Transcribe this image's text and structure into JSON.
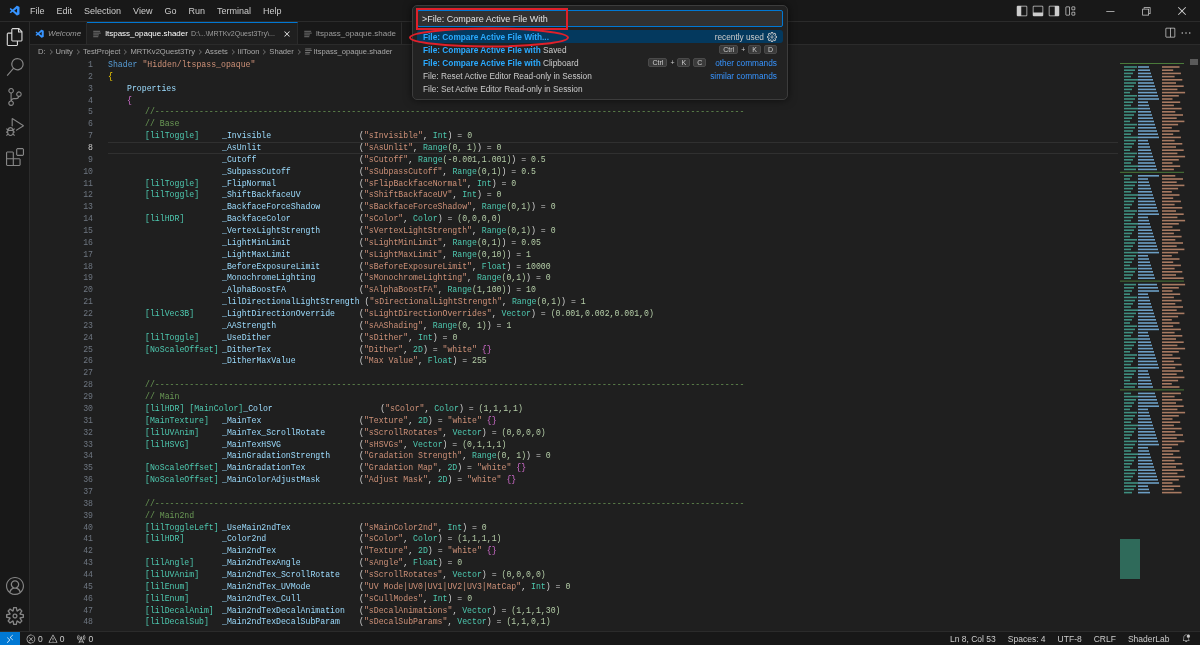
{
  "menu": [
    "File",
    "Edit",
    "Selection",
    "View",
    "Go",
    "Run",
    "Terminal",
    "Help"
  ],
  "tabs": [
    {
      "label": "Welcome",
      "preview": true,
      "selected": false
    },
    {
      "label": "ltspass_opaque.shader",
      "description": "D:\\...\\MRTKv2Quest3Try\\...",
      "preview": false,
      "selected": true
    },
    {
      "label": "ltspass_opaque.shade",
      "preview": false,
      "selected": false
    }
  ],
  "breadcrumbs": [
    "D:",
    "Unity",
    "TestProject",
    "MRTKv2Quest3Try",
    "Assets",
    "lilToon",
    "Shader",
    "ltspass_opaque.shader"
  ],
  "editor": {
    "lines": [
      {
        "number": "1",
        "current": false,
        "kind": "header",
        "code": [
          {
            "kind": "keyword",
            "text": "Shader"
          },
          {
            "kind": "string",
            "text": " \"Hidden/ltspass_opaque\""
          }
        ]
      },
      {
        "number": "2",
        "current": false,
        "kind": "header",
        "code": [
          {
            "kind": "bracket",
            "text": "{"
          }
        ]
      },
      {
        "number": "3",
        "current": false,
        "kind": "section",
        "code": [
          {
            "kind": "variable",
            "text": "Properties"
          }
        ]
      },
      {
        "number": "4",
        "current": false,
        "kind": "section",
        "code": [
          {
            "kind": "brace",
            "text": "{"
          }
        ]
      },
      {
        "number": "5",
        "current": false,
        "kind": "comment",
        "text": "//------------------------------------------------------------------------------------------------------------------------"
      },
      {
        "number": "6",
        "current": false,
        "kind": "comment",
        "text": "// Base"
      },
      {
        "number": "7",
        "current": false,
        "kind": "decl",
        "attr": "[lilToggle]",
        "name": "_Invisible",
        "desc": [
          {
            "kind": "plain",
            "text": "("
          },
          {
            "kind": "string",
            "text": "\"sInvisible\""
          },
          {
            "kind": "plain",
            "text": ", "
          },
          {
            "kind": "type",
            "text": "Int"
          },
          {
            "kind": "plain",
            "text": ") = "
          },
          {
            "kind": "number",
            "text": "0"
          }
        ]
      },
      {
        "number": "8",
        "current": true,
        "kind": "decl",
        "name": "_AsUnlit",
        "desc": [
          {
            "kind": "plain",
            "text": "("
          },
          {
            "kind": "string",
            "text": "\"sAsUnlit\""
          },
          {
            "kind": "plain",
            "text": ", "
          },
          {
            "kind": "type",
            "text": "Range"
          },
          {
            "kind": "number",
            "text": "(0, 1)"
          },
          {
            "kind": "plain",
            "text": ") = "
          },
          {
            "kind": "number",
            "text": "0"
          }
        ]
      },
      {
        "number": "9",
        "current": false,
        "kind": "decl",
        "name": "_Cutoff",
        "desc": [
          {
            "kind": "plain",
            "text": "("
          },
          {
            "kind": "string",
            "text": "\"sCutoff\""
          },
          {
            "kind": "plain",
            "text": ", "
          },
          {
            "kind": "type",
            "text": "Range"
          },
          {
            "kind": "number",
            "text": "(-0.001,1.001)"
          },
          {
            "kind": "plain",
            "text": ") = "
          },
          {
            "kind": "number",
            "text": "0.5"
          }
        ]
      },
      {
        "number": "10",
        "current": false,
        "kind": "decl",
        "name": "_SubpassCutoff",
        "desc": [
          {
            "kind": "plain",
            "text": "("
          },
          {
            "kind": "string",
            "text": "\"sSubpassCutoff\""
          },
          {
            "kind": "plain",
            "text": ", "
          },
          {
            "kind": "type",
            "text": "Range"
          },
          {
            "kind": "number",
            "text": "(0,1)"
          },
          {
            "kind": "plain",
            "text": ") = "
          },
          {
            "kind": "number",
            "text": "0.5"
          }
        ]
      },
      {
        "number": "11",
        "current": false,
        "kind": "decl",
        "attr": "[lilToggle]",
        "name": "_FlipNormal",
        "desc": [
          {
            "kind": "plain",
            "text": "("
          },
          {
            "kind": "string",
            "text": "\"sFlipBackfaceNormal\""
          },
          {
            "kind": "plain",
            "text": ", "
          },
          {
            "kind": "type",
            "text": "Int"
          },
          {
            "kind": "plain",
            "text": ") = "
          },
          {
            "kind": "number",
            "text": "0"
          }
        ]
      },
      {
        "number": "12",
        "current": false,
        "kind": "decl",
        "attr": "[lilToggle]",
        "name": "_ShiftBackfaceUV",
        "desc": [
          {
            "kind": "plain",
            "text": "("
          },
          {
            "kind": "string",
            "text": "\"sShiftBackfaceUV\""
          },
          {
            "kind": "plain",
            "text": ", "
          },
          {
            "kind": "type",
            "text": "Int"
          },
          {
            "kind": "plain",
            "text": ") = "
          },
          {
            "kind": "number",
            "text": "0"
          }
        ]
      },
      {
        "number": "13",
        "current": false,
        "kind": "decl",
        "name": "_BackfaceForceShadow",
        "desc": [
          {
            "kind": "plain",
            "text": "("
          },
          {
            "kind": "string",
            "text": "\"sBackfaceForceShadow\""
          },
          {
            "kind": "plain",
            "text": ", "
          },
          {
            "kind": "type",
            "text": "Range"
          },
          {
            "kind": "number",
            "text": "(0,1)"
          },
          {
            "kind": "plain",
            "text": ") = "
          },
          {
            "kind": "number",
            "text": "0"
          }
        ]
      },
      {
        "number": "14",
        "current": false,
        "kind": "decl",
        "attr": "[lilHDR]",
        "name": "_BackfaceColor",
        "desc": [
          {
            "kind": "plain",
            "text": "("
          },
          {
            "kind": "string",
            "text": "\"sColor\""
          },
          {
            "kind": "plain",
            "text": ", "
          },
          {
            "kind": "type",
            "text": "Color"
          },
          {
            "kind": "plain",
            "text": ") = "
          },
          {
            "kind": "number",
            "text": "(0,0,0,0)"
          }
        ]
      },
      {
        "number": "15",
        "current": false,
        "kind": "decl",
        "name": "_VertexLightStrength",
        "desc": [
          {
            "kind": "plain",
            "text": "("
          },
          {
            "kind": "string",
            "text": "\"sVertexLightStrength\""
          },
          {
            "kind": "plain",
            "text": ", "
          },
          {
            "kind": "type",
            "text": "Range"
          },
          {
            "kind": "number",
            "text": "(0,1)"
          },
          {
            "kind": "plain",
            "text": ") = "
          },
          {
            "kind": "number",
            "text": "0"
          }
        ]
      },
      {
        "number": "16",
        "current": false,
        "kind": "decl",
        "name": "_LightMinLimit",
        "desc": [
          {
            "kind": "plain",
            "text": "("
          },
          {
            "kind": "string",
            "text": "\"sLightMinLimit\""
          },
          {
            "kind": "plain",
            "text": ", "
          },
          {
            "kind": "type",
            "text": "Range"
          },
          {
            "kind": "number",
            "text": "(0,1)"
          },
          {
            "kind": "plain",
            "text": ") = "
          },
          {
            "kind": "number",
            "text": "0.05"
          }
        ]
      },
      {
        "number": "17",
        "current": false,
        "kind": "decl",
        "name": "_LightMaxLimit",
        "desc": [
          {
            "kind": "plain",
            "text": "("
          },
          {
            "kind": "string",
            "text": "\"sLightMaxLimit\""
          },
          {
            "kind": "plain",
            "text": ", "
          },
          {
            "kind": "type",
            "text": "Range"
          },
          {
            "kind": "number",
            "text": "(0,10)"
          },
          {
            "kind": "plain",
            "text": ") = "
          },
          {
            "kind": "number",
            "text": "1"
          }
        ]
      },
      {
        "number": "18",
        "current": false,
        "kind": "decl",
        "name": "_BeforeExposureLimit",
        "desc": [
          {
            "kind": "plain",
            "text": "("
          },
          {
            "kind": "string",
            "text": "\"sBeforeExposureLimit\""
          },
          {
            "kind": "plain",
            "text": ", "
          },
          {
            "kind": "type",
            "text": "Float"
          },
          {
            "kind": "plain",
            "text": ") = "
          },
          {
            "kind": "number",
            "text": "10000"
          }
        ]
      },
      {
        "number": "19",
        "current": false,
        "kind": "decl",
        "name": "_MonochromeLighting",
        "desc": [
          {
            "kind": "plain",
            "text": "("
          },
          {
            "kind": "string",
            "text": "\"sMonochromeLighting\""
          },
          {
            "kind": "plain",
            "text": ", "
          },
          {
            "kind": "type",
            "text": "Range"
          },
          {
            "kind": "number",
            "text": "(0,1)"
          },
          {
            "kind": "plain",
            "text": ") = "
          },
          {
            "kind": "number",
            "text": "0"
          }
        ]
      },
      {
        "number": "20",
        "current": false,
        "kind": "decl",
        "name": "_AlphaBoostFA",
        "desc": [
          {
            "kind": "plain",
            "text": "("
          },
          {
            "kind": "string",
            "text": "\"sAlphaBoostFA\""
          },
          {
            "kind": "plain",
            "text": ", "
          },
          {
            "kind": "type",
            "text": "Range"
          },
          {
            "kind": "number",
            "text": "(1,100)"
          },
          {
            "kind": "plain",
            "text": ") = "
          },
          {
            "kind": "number",
            "text": "10"
          }
        ]
      },
      {
        "number": "21",
        "current": false,
        "kind": "decl",
        "name": "_lilDirectionalLightStrength",
        "desc": [
          {
            "kind": "plain",
            "text": " ("
          },
          {
            "kind": "string",
            "text": "\"sDirectionalLightStrength\""
          },
          {
            "kind": "plain",
            "text": ", "
          },
          {
            "kind": "type",
            "text": "Range"
          },
          {
            "kind": "number",
            "text": "(0,1)"
          },
          {
            "kind": "plain",
            "text": ") = "
          },
          {
            "kind": "number",
            "text": "1"
          }
        ]
      },
      {
        "number": "22",
        "current": false,
        "kind": "decl",
        "attr": "[lilVec3B]",
        "name": "_LightDirectionOverride",
        "desc": [
          {
            "kind": "plain",
            "text": "("
          },
          {
            "kind": "string",
            "text": "\"sLightDirectionOverrides\""
          },
          {
            "kind": "plain",
            "text": ", "
          },
          {
            "kind": "type",
            "text": "Vector"
          },
          {
            "kind": "plain",
            "text": ") = "
          },
          {
            "kind": "number",
            "text": "(0.001,0.002,0.001,0)"
          }
        ]
      },
      {
        "number": "23",
        "current": false,
        "kind": "decl",
        "name": "_AAStrength",
        "desc": [
          {
            "kind": "plain",
            "text": "("
          },
          {
            "kind": "string",
            "text": "\"sAAShading\""
          },
          {
            "kind": "plain",
            "text": ", "
          },
          {
            "kind": "type",
            "text": "Range"
          },
          {
            "kind": "number",
            "text": "(0, 1)"
          },
          {
            "kind": "plain",
            "text": ") = "
          },
          {
            "kind": "number",
            "text": "1"
          }
        ]
      },
      {
        "number": "24",
        "current": false,
        "kind": "decl",
        "attr": "[lilToggle]",
        "name": "_UseDither",
        "desc": [
          {
            "kind": "plain",
            "text": "("
          },
          {
            "kind": "string",
            "text": "\"sDither\""
          },
          {
            "kind": "plain",
            "text": ", "
          },
          {
            "kind": "type",
            "text": "Int"
          },
          {
            "kind": "plain",
            "text": ") = "
          },
          {
            "kind": "number",
            "text": "0"
          }
        ]
      },
      {
        "number": "25",
        "current": false,
        "kind": "decl",
        "attr": "[NoScaleOffset]",
        "name": "_DitherTex",
        "desc": [
          {
            "kind": "plain",
            "text": "("
          },
          {
            "kind": "string",
            "text": "\"Dither\""
          },
          {
            "kind": "plain",
            "text": ", "
          },
          {
            "kind": "type",
            "text": "2D"
          },
          {
            "kind": "plain",
            "text": ") = "
          },
          {
            "kind": "string",
            "text": "\"white\""
          },
          {
            "kind": "brace",
            "text": " {}"
          }
        ]
      },
      {
        "number": "26",
        "current": false,
        "kind": "decl",
        "name": "_DitherMaxValue",
        "desc": [
          {
            "kind": "plain",
            "text": "("
          },
          {
            "kind": "string",
            "text": "\"Max Value\""
          },
          {
            "kind": "plain",
            "text": ", "
          },
          {
            "kind": "type",
            "text": "Float"
          },
          {
            "kind": "plain",
            "text": ") = "
          },
          {
            "kind": "number",
            "text": "255"
          }
        ]
      },
      {
        "number": "27",
        "current": false,
        "kind": "blank"
      },
      {
        "number": "28",
        "current": false,
        "kind": "comment",
        "text": "//------------------------------------------------------------------------------------------------------------------------"
      },
      {
        "number": "29",
        "current": false,
        "kind": "comment",
        "text": "// Main"
      },
      {
        "number": "30",
        "current": false,
        "kind": "decl",
        "attr": "[lilHDR] [MainColor]",
        "name": "_Color",
        "desc": [
          {
            "kind": "plain",
            "text": "("
          },
          {
            "kind": "string",
            "text": "\"sColor\""
          },
          {
            "kind": "plain",
            "text": ", "
          },
          {
            "kind": "type",
            "text": "Color"
          },
          {
            "kind": "plain",
            "text": ") = "
          },
          {
            "kind": "number",
            "text": "(1,1,1,1)"
          }
        ]
      },
      {
        "number": "31",
        "current": false,
        "kind": "decl",
        "attr": "[MainTexture]",
        "name": "_MainTex",
        "desc": [
          {
            "kind": "plain",
            "text": "("
          },
          {
            "kind": "string",
            "text": "\"Texture\""
          },
          {
            "kind": "plain",
            "text": ", "
          },
          {
            "kind": "type",
            "text": "2D"
          },
          {
            "kind": "plain",
            "text": ") = "
          },
          {
            "kind": "string",
            "text": "\"white\""
          },
          {
            "kind": "brace",
            "text": " {}"
          }
        ]
      },
      {
        "number": "32",
        "current": false,
        "kind": "decl",
        "attr": "[lilUVAnim]",
        "name": "_MainTex_ScrollRotate",
        "desc": [
          {
            "kind": "plain",
            "text": "("
          },
          {
            "kind": "string",
            "text": "\"sScrollRotates\""
          },
          {
            "kind": "plain",
            "text": ", "
          },
          {
            "kind": "type",
            "text": "Vector"
          },
          {
            "kind": "plain",
            "text": ") = "
          },
          {
            "kind": "number",
            "text": "(0,0,0,0)"
          }
        ]
      },
      {
        "number": "33",
        "current": false,
        "kind": "decl",
        "attr": "[lilHSVG]",
        "name": "_MainTexHSVG",
        "desc": [
          {
            "kind": "plain",
            "text": "("
          },
          {
            "kind": "string",
            "text": "\"sHSVGs\""
          },
          {
            "kind": "plain",
            "text": ", "
          },
          {
            "kind": "type",
            "text": "Vector"
          },
          {
            "kind": "plain",
            "text": ") = "
          },
          {
            "kind": "number",
            "text": "(0,1,1,1)"
          }
        ]
      },
      {
        "number": "34",
        "current": false,
        "kind": "decl",
        "name": "_MainGradationStrength",
        "desc": [
          {
            "kind": "plain",
            "text": "("
          },
          {
            "kind": "string",
            "text": "\"Gradation Strength\""
          },
          {
            "kind": "plain",
            "text": ", "
          },
          {
            "kind": "type",
            "text": "Range"
          },
          {
            "kind": "number",
            "text": "(0, 1)"
          },
          {
            "kind": "plain",
            "text": ") = "
          },
          {
            "kind": "number",
            "text": "0"
          }
        ]
      },
      {
        "number": "35",
        "current": false,
        "kind": "decl",
        "attr": "[NoScaleOffset]",
        "name": "_MainGradationTex",
        "desc": [
          {
            "kind": "plain",
            "text": "("
          },
          {
            "kind": "string",
            "text": "\"Gradation Map\""
          },
          {
            "kind": "plain",
            "text": ", "
          },
          {
            "kind": "type",
            "text": "2D"
          },
          {
            "kind": "plain",
            "text": ") = "
          },
          {
            "kind": "string",
            "text": "\"white\""
          },
          {
            "kind": "brace",
            "text": " {}"
          }
        ]
      },
      {
        "number": "36",
        "current": false,
        "kind": "decl",
        "attr": "[NoScaleOffset]",
        "name": "_MainColorAdjustMask",
        "desc": [
          {
            "kind": "plain",
            "text": "("
          },
          {
            "kind": "string",
            "text": "\"Adjust Mask\""
          },
          {
            "kind": "plain",
            "text": ", "
          },
          {
            "kind": "type",
            "text": "2D"
          },
          {
            "kind": "plain",
            "text": ") = "
          },
          {
            "kind": "string",
            "text": "\"white\""
          },
          {
            "kind": "brace",
            "text": " {}"
          }
        ]
      },
      {
        "number": "37",
        "current": false,
        "kind": "blank"
      },
      {
        "number": "38",
        "current": false,
        "kind": "comment",
        "text": "//------------------------------------------------------------------------------------------------------------------------"
      },
      {
        "number": "39",
        "current": false,
        "kind": "comment",
        "text": "// Main2nd"
      },
      {
        "number": "40",
        "current": false,
        "kind": "decl",
        "attr": "[lilToggleLeft]",
        "name": "_UseMain2ndTex",
        "desc": [
          {
            "kind": "plain",
            "text": "("
          },
          {
            "kind": "string",
            "text": "\"sMainColor2nd\""
          },
          {
            "kind": "plain",
            "text": ", "
          },
          {
            "kind": "type",
            "text": "Int"
          },
          {
            "kind": "plain",
            "text": ") = "
          },
          {
            "kind": "number",
            "text": "0"
          }
        ]
      },
      {
        "number": "41",
        "current": false,
        "kind": "decl",
        "attr": "[lilHDR]",
        "name": "_Color2nd",
        "desc": [
          {
            "kind": "plain",
            "text": "("
          },
          {
            "kind": "string",
            "text": "\"sColor\""
          },
          {
            "kind": "plain",
            "text": ", "
          },
          {
            "kind": "type",
            "text": "Color"
          },
          {
            "kind": "plain",
            "text": ") = "
          },
          {
            "kind": "number",
            "text": "(1,1,1,1)"
          }
        ]
      },
      {
        "number": "42",
        "current": false,
        "kind": "decl",
        "name": "_Main2ndTex",
        "desc": [
          {
            "kind": "plain",
            "text": "("
          },
          {
            "kind": "string",
            "text": "\"Texture\""
          },
          {
            "kind": "plain",
            "text": ", "
          },
          {
            "kind": "type",
            "text": "2D"
          },
          {
            "kind": "plain",
            "text": ") = "
          },
          {
            "kind": "string",
            "text": "\"white\""
          },
          {
            "kind": "brace",
            "text": " {}"
          }
        ]
      },
      {
        "number": "43",
        "current": false,
        "kind": "decl",
        "attr": "[lilAngle]",
        "name": "_Main2ndTexAngle",
        "desc": [
          {
            "kind": "plain",
            "text": "("
          },
          {
            "kind": "string",
            "text": "\"sAngle\""
          },
          {
            "kind": "plain",
            "text": ", "
          },
          {
            "kind": "type",
            "text": "Float"
          },
          {
            "kind": "plain",
            "text": ") = "
          },
          {
            "kind": "number",
            "text": "0"
          }
        ]
      },
      {
        "number": "44",
        "current": false,
        "kind": "decl",
        "attr": "[lilUVAnim]",
        "name": "_Main2ndTex_ScrollRotate",
        "desc": [
          {
            "kind": "plain",
            "text": "("
          },
          {
            "kind": "string",
            "text": "\"sScrollRotates\""
          },
          {
            "kind": "plain",
            "text": ", "
          },
          {
            "kind": "type",
            "text": "Vector"
          },
          {
            "kind": "plain",
            "text": ") = "
          },
          {
            "kind": "number",
            "text": "(0,0,0,0)"
          }
        ]
      },
      {
        "number": "45",
        "current": false,
        "kind": "decl",
        "attr": "[lilEnum]",
        "name": "_Main2ndTex_UVMode",
        "desc": [
          {
            "kind": "plain",
            "text": "("
          },
          {
            "kind": "string",
            "text": "\"UV Mode|UV0|UV1|UV2|UV3|MatCap\""
          },
          {
            "kind": "plain",
            "text": ", "
          },
          {
            "kind": "type",
            "text": "Int"
          },
          {
            "kind": "plain",
            "text": ") = "
          },
          {
            "kind": "number",
            "text": "0"
          }
        ]
      },
      {
        "number": "46",
        "current": false,
        "kind": "decl",
        "attr": "[lilEnum]",
        "name": "_Main2ndTex_Cull",
        "desc": [
          {
            "kind": "plain",
            "text": "("
          },
          {
            "kind": "string",
            "text": "\"sCullModes\""
          },
          {
            "kind": "plain",
            "text": ", "
          },
          {
            "kind": "type",
            "text": "Int"
          },
          {
            "kind": "plain",
            "text": ") = "
          },
          {
            "kind": "number",
            "text": "0"
          }
        ]
      },
      {
        "number": "47",
        "current": false,
        "kind": "decl",
        "attr": "[lilDecalAnim]",
        "name": "_Main2ndTexDecalAnimation",
        "desc": [
          {
            "kind": "plain",
            "text": "("
          },
          {
            "kind": "string",
            "text": "\"sDecalAnimations\""
          },
          {
            "kind": "plain",
            "text": ", "
          },
          {
            "kind": "type",
            "text": "Vector"
          },
          {
            "kind": "plain",
            "text": ") = "
          },
          {
            "kind": "number",
            "text": "(1,1,1,30)"
          }
        ]
      },
      {
        "number": "48",
        "current": false,
        "kind": "decl",
        "attr": "[lilDecalSub]",
        "name": "_Main2ndTexDecalSubParam",
        "desc": [
          {
            "kind": "plain",
            "text": "("
          },
          {
            "kind": "string",
            "text": "\"sDecalSubParams\""
          },
          {
            "kind": "plain",
            "text": ", "
          },
          {
            "kind": "type",
            "text": "Vector"
          },
          {
            "kind": "plain",
            "text": ") = "
          },
          {
            "kind": "number",
            "text": "(1,1,0,1)"
          }
        ]
      }
    ]
  },
  "command_palette": {
    "query": ">File: Compare Active File With",
    "query_framed": true,
    "joiner": "+",
    "items": [
      {
        "match": "File: Compare Active File With...",
        "selected": true,
        "circled": true,
        "hint": "recently used"
      },
      {
        "match": "File: Compare Active File with",
        "rest": " Saved",
        "selected": false,
        "circled": false,
        "chords": [
          [
            "Ctrl",
            "K"
          ],
          [
            "D"
          ]
        ]
      },
      {
        "match": "File: Compare Active File with",
        "rest": " Clipboard",
        "selected": false,
        "circled": false,
        "chords": [
          [
            "Ctrl",
            "K"
          ],
          [
            "C"
          ]
        ],
        "link": "other commands"
      },
      {
        "rest": "File: Reset Active Editor Read-only in Session",
        "selected": false,
        "circled": false,
        "link": "similar commands"
      },
      {
        "rest": "File: Set Active Editor Read-only in Session",
        "selected": false,
        "circled": false
      }
    ]
  },
  "status_bar": {
    "errors": "0",
    "warnings": "0",
    "ports": "0",
    "items": [
      "Ln 8, Col 53",
      "Spaces: 4",
      "UTF-8",
      "CRLF",
      "ShaderLab"
    ]
  }
}
